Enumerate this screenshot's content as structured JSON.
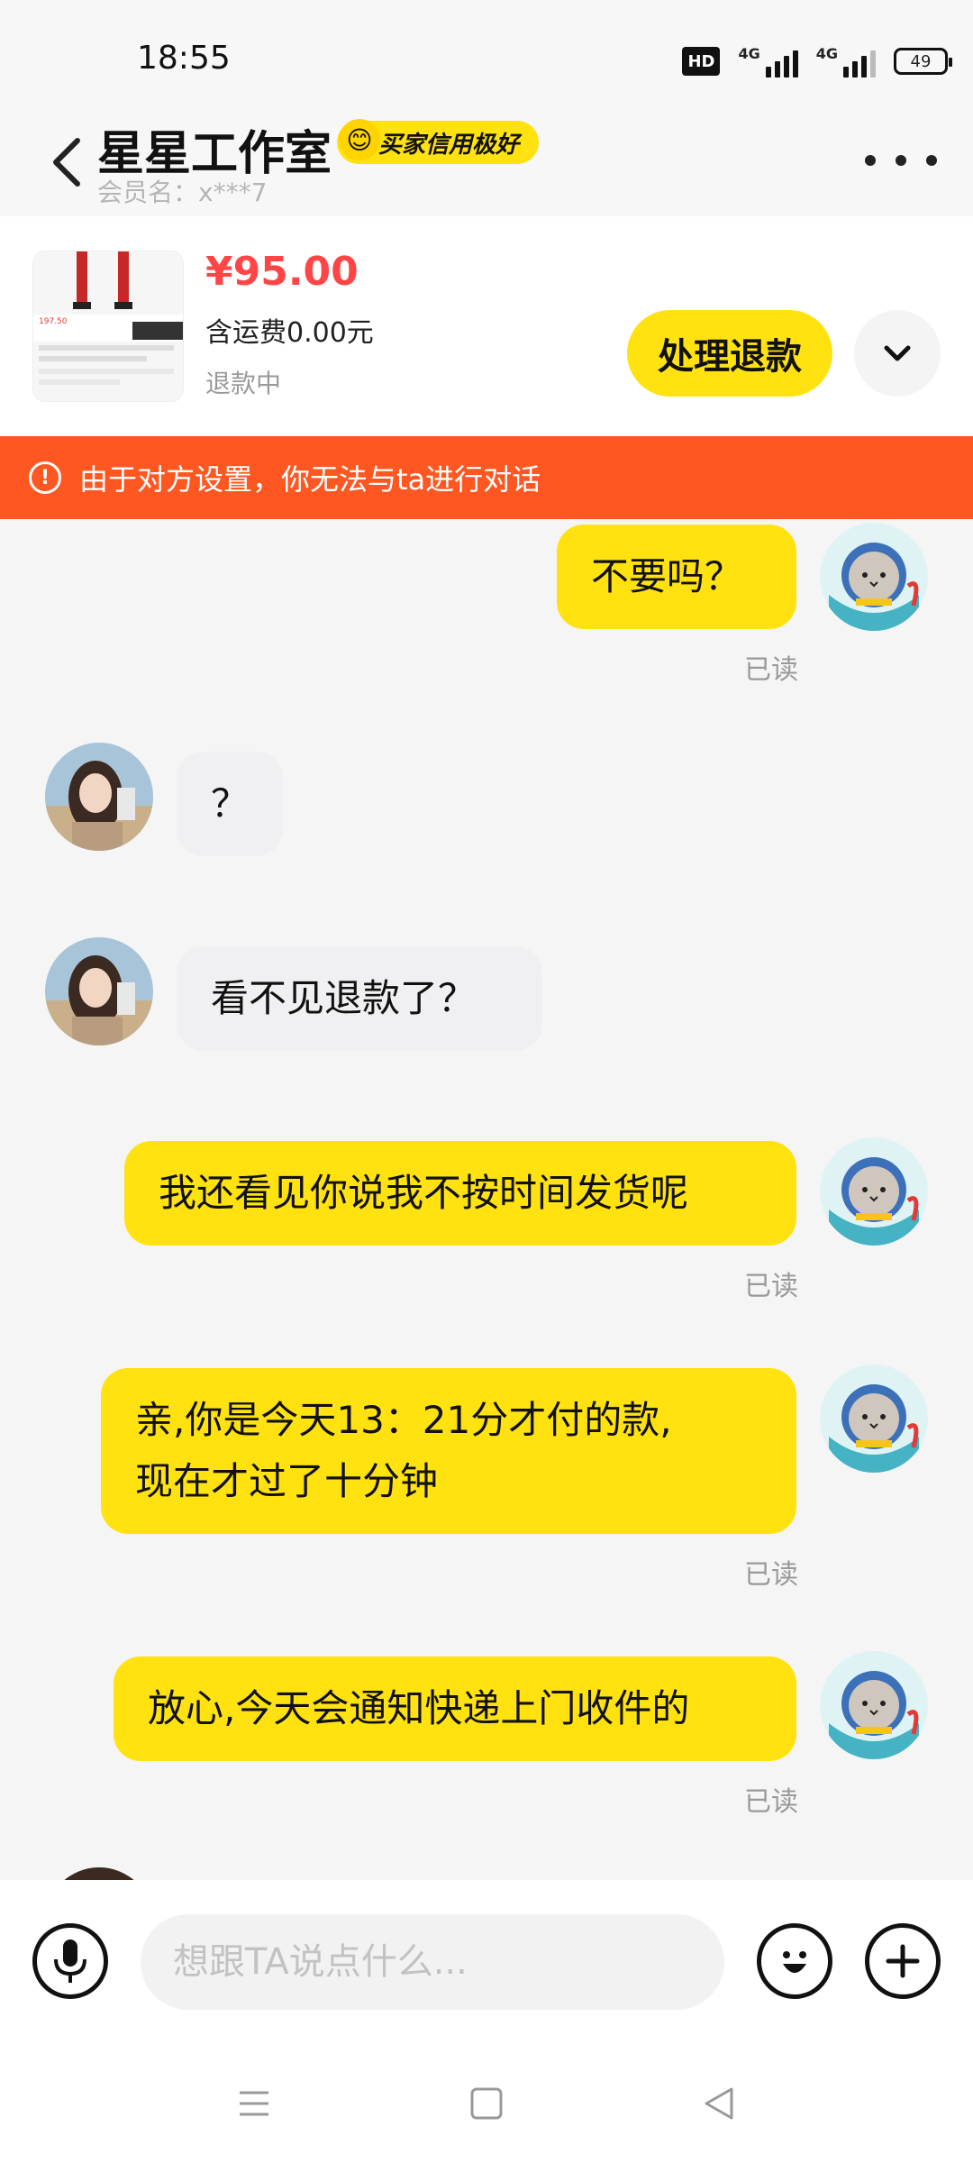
{
  "status_bar": {
    "time": "18:55",
    "hd": "HD",
    "signal1_label": "4G",
    "signal2_label": "4G",
    "battery": "49"
  },
  "header": {
    "shop_name": "星星工作室",
    "credit_badge": "买家信用极好",
    "member": "会员名：x***7"
  },
  "order": {
    "price": "¥95.00",
    "shipping": "含运费0.00元",
    "status": "退款中",
    "action_label": "处理退款",
    "thumb_price": "197.50"
  },
  "banner": {
    "text": "由于对方设置，你无法与ta进行对话"
  },
  "messages": [
    {
      "side": "mine",
      "text": "不要吗？",
      "read": "已读"
    },
    {
      "side": "theirs",
      "text": "？"
    },
    {
      "side": "theirs",
      "text": "看不见退款了？"
    },
    {
      "side": "mine",
      "text": "我还看见你说我不按时间发货呢",
      "read": "已读"
    },
    {
      "side": "mine",
      "line1": "亲,你是今天13：21分才付的款,",
      "line2": "现在才过了十分钟",
      "read": "已读"
    },
    {
      "side": "mine",
      "text": "放心,今天会通知快递上门收件的",
      "read": "已读"
    }
  ],
  "input": {
    "placeholder": "想跟TA说点什么..."
  },
  "colors": {
    "accent_yellow": "#ffe20f",
    "warning_orange": "#ff5722",
    "price_red": "#ff4545"
  },
  "icons": [
    "back-icon",
    "more-icon",
    "chevron-down-icon",
    "warning-icon",
    "mic-icon",
    "emoji-icon",
    "plus-icon",
    "menu-icon",
    "home-icon",
    "back-triangle-icon"
  ]
}
